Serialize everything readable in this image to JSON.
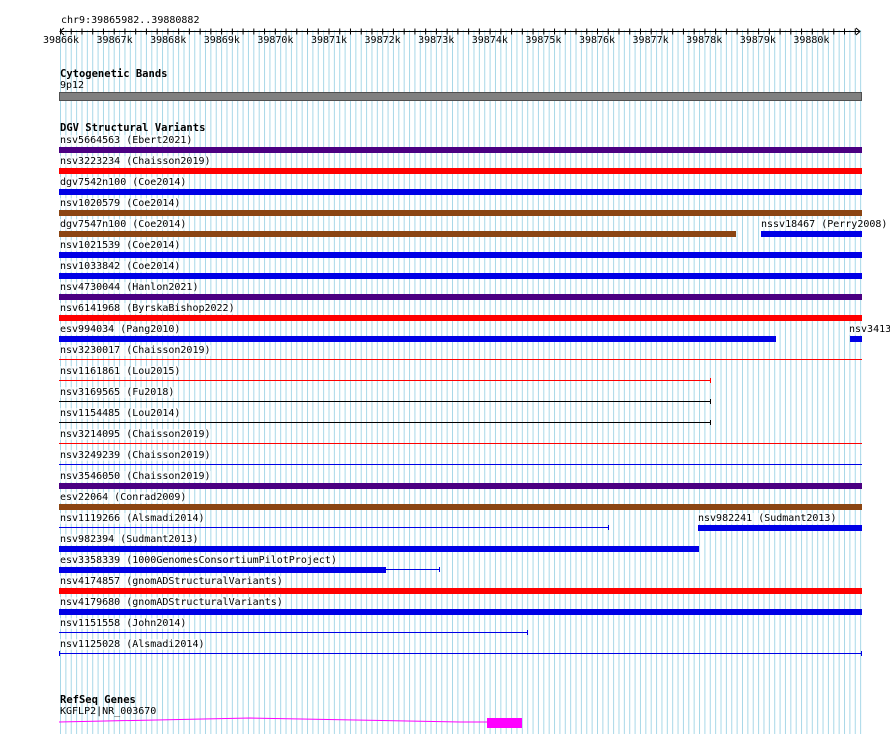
{
  "location": "chr9:39865982..39880882",
  "ruler": {
    "ticks": [
      "39866k",
      "39867k",
      "39868k",
      "39869k",
      "39870k",
      "39871k",
      "39872k",
      "39873k",
      "39874k",
      "39875k",
      "39876k",
      "39877k",
      "39878k",
      "39879k",
      "39880k"
    ]
  },
  "colors": {
    "grid": "#a8d8e8",
    "purple": "#4b0082",
    "red": "#ff0000",
    "blue": "#0000e6",
    "brown": "#8b4513",
    "black": "#000000",
    "magenta": "#ff00ff",
    "band_gray": "#808080"
  },
  "cytobands": {
    "title": "Cytogenetic Bands",
    "band": "9p12"
  },
  "dgv": {
    "title": "DGV Structural Variants",
    "rows": [
      {
        "labels": [
          "nsv5664563 (Ebert2021)"
        ]
      },
      {
        "labels": [
          "nsv3223234 (Chaisson2019)"
        ]
      },
      {
        "labels": [
          "dgv7542n100 (Coe2014)"
        ]
      },
      {
        "labels": [
          "nsv1020579 (Coe2014)"
        ]
      },
      {
        "labels": [
          "dgv7547n100 (Coe2014)",
          "nssv18467 (Perry2008)"
        ]
      },
      {
        "labels": [
          "nsv1021539 (Coe2014)"
        ]
      },
      {
        "labels": [
          "nsv1033842 (Coe2014)"
        ]
      },
      {
        "labels": [
          "nsv4730044 (Hanlon2021)"
        ]
      },
      {
        "labels": [
          "nsv6141968 (ByrskaBishop2022)"
        ]
      },
      {
        "labels": [
          "esv994034 (Pang2010)",
          "nsv3413"
        ]
      },
      {
        "labels": [
          "nsv3230017 (Chaisson2019)"
        ]
      },
      {
        "labels": [
          "nsv1161861 (Lou2015)"
        ]
      },
      {
        "labels": [
          "nsv3169565 (Fu2018)"
        ]
      },
      {
        "labels": [
          "nsv1154485 (Lou2014)"
        ]
      },
      {
        "labels": [
          "nsv3214095 (Chaisson2019)"
        ]
      },
      {
        "labels": [
          "nsv3249239 (Chaisson2019)"
        ]
      },
      {
        "labels": [
          "nsv3546050 (Chaisson2019)"
        ]
      },
      {
        "labels": [
          "esv22064 (Conrad2009)"
        ]
      },
      {
        "labels": [
          "nsv1119266 (Alsmadi2014)",
          "nsv982241 (Sudmant2013)"
        ]
      },
      {
        "labels": [
          "nsv982394 (Sudmant2013)"
        ]
      },
      {
        "labels": [
          "esv3358339 (1000GenomesConsortiumPilotProject)"
        ]
      },
      {
        "labels": [
          "nsv4174857 (gnomADStructuralVariants)"
        ]
      },
      {
        "labels": [
          "nsv4179680 (gnomADStructuralVariants)"
        ]
      },
      {
        "labels": [
          "nsv1151558 (John2014)"
        ]
      },
      {
        "labels": [
          "nsv1125028 (Alsmadi2014)"
        ]
      }
    ]
  },
  "refseq": {
    "title": "RefSeq Genes",
    "gene_label": "KGFLP2|NR_003670"
  }
}
